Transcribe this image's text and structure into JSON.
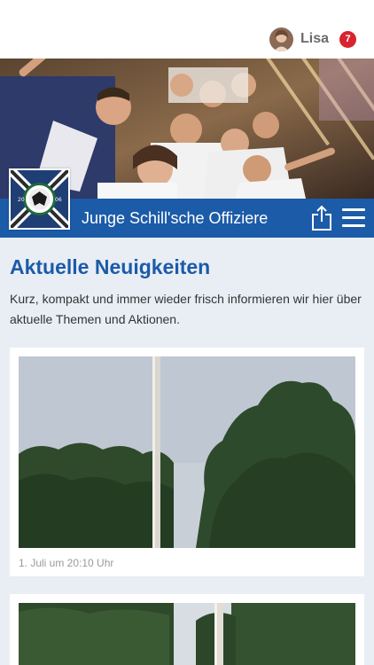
{
  "header": {
    "username": "Lisa",
    "notification_count": "7"
  },
  "club": {
    "title": "Junge Schill'sche Offiziere"
  },
  "news": {
    "heading": "Aktuelle Neuigkeiten",
    "intro": "Kurz, kompakt und immer wieder frisch informieren wir hier über aktuelle Themen und Aktionen.",
    "posts": [
      {
        "timestamp": "1. Juli um 20:10 Uhr"
      }
    ]
  },
  "colors": {
    "brand_blue": "#1c5ba8",
    "badge_red": "#d9232e",
    "page_bg": "#e9eef5"
  },
  "icons": {
    "share": "share-icon",
    "menu": "hamburger-menu-icon"
  }
}
